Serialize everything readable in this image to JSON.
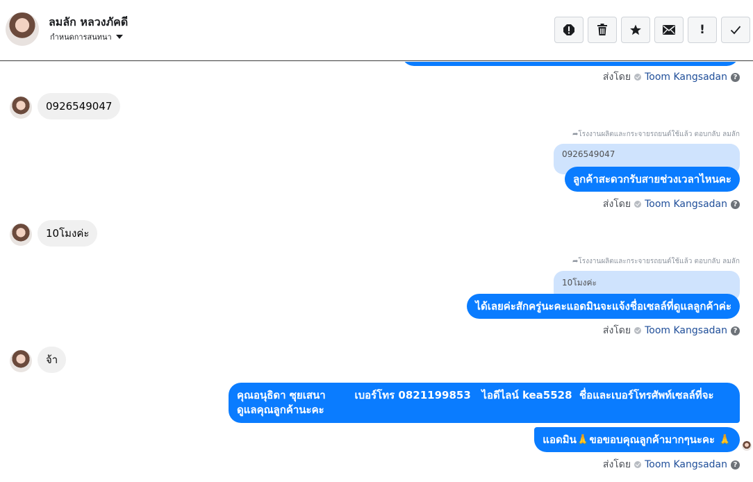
{
  "header": {
    "contact_name": "ลมลัก หลวงภัคดี",
    "conversation_menu_label": "กำหนดการสนทนา",
    "toolbar": [
      {
        "name": "alert-icon",
        "label": "spam"
      },
      {
        "name": "trash-icon",
        "label": "delete"
      },
      {
        "name": "star-icon",
        "label": "star"
      },
      {
        "name": "mail-icon",
        "label": "mark unread"
      },
      {
        "name": "exclamation-icon",
        "label": "!"
      },
      {
        "name": "check-icon",
        "label": "done"
      }
    ]
  },
  "sent_by": {
    "prefix": "ส่งโดย",
    "agent": "Toom Kangsadan",
    "help_icon": "?"
  },
  "messages": [
    {
      "type": "incoming",
      "text": "0926549047"
    },
    {
      "type": "outgoing",
      "reply_note": "โรงงานผลิตและกระจายรถยนต์ใช้แล้ว ตอบกลับ ลมลัก",
      "quote": "0926549047",
      "text": "ลูกค้าสะดวกรับสายช่วงเวลาไหนคะ"
    },
    {
      "type": "incoming",
      "text": "10โมงค่ะ"
    },
    {
      "type": "outgoing",
      "reply_note": "โรงงานผลิตและกระจายรถยนต์ใช้แล้ว ตอบกลับ ลมลัก",
      "quote": "10โมงค่ะ",
      "text": "ได้เลยค่ะสักครู่นะคะแอดมินจะแจ้งชื่อเซลล์ที่ดูแลลูกค้าค่ะ"
    },
    {
      "type": "incoming",
      "text": "จ้า"
    },
    {
      "type": "outgoing",
      "text": "คุณอนุธิดา ซุยเสนา        เบอร์โทร 0821199853   ไอดีไลน์ kea5528  ชื่อและเบอร์โทรศัพท์เซลล์ที่จะดูแลคุณลูกค้านะคะ"
    },
    {
      "type": "outgoing",
      "text": "แอดมิน🙏ขอขอบคุณลูกค้ามากๆนะคะ 🙏"
    }
  ]
}
